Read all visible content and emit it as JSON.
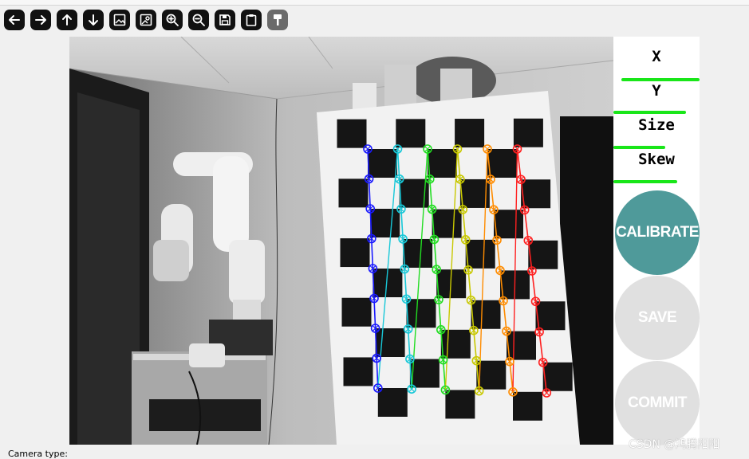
{
  "toolbar": {
    "icons": [
      "arrow-left-icon",
      "arrow-right-icon",
      "arrow-up-icon",
      "arrow-down-icon",
      "image-icon",
      "image-person-icon",
      "zoom-in-icon",
      "zoom-out-icon",
      "save-icon",
      "clipboard-icon",
      "brush-icon"
    ]
  },
  "sidebar": {
    "x_label": "X",
    "y_label": "Y",
    "size_label": "Size",
    "skew_label": "Skew",
    "x_progress": 0.9,
    "y_progress": 0.85,
    "size_progress": 0.6,
    "skew_progress": 0.75,
    "bar_color": "#19e619",
    "calibrate_label": "CALIBRATE",
    "calibrate_color": "#4f9a9a",
    "save_label": "SAVE",
    "commit_label": "COMMIT",
    "disabled_color": "#e0e0e0"
  },
  "status": {
    "camera_type_label": "Camera type:"
  },
  "watermark": "CSDN @鸿腾阳阳",
  "corner_colors": [
    "#1a1aff",
    "#18c8d8",
    "#22dd22",
    "#c8c800",
    "#ff8c00",
    "#ff2020"
  ]
}
